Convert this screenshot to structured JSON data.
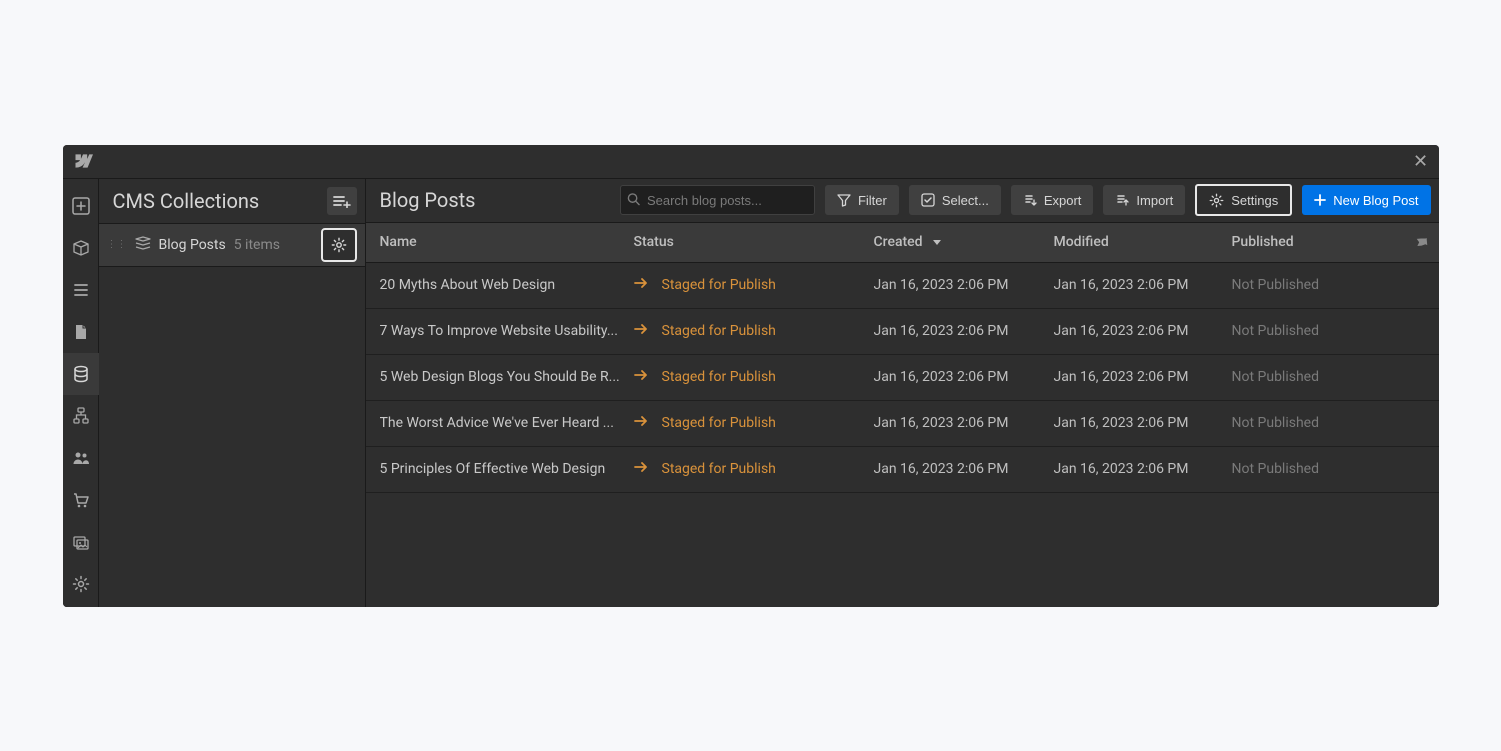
{
  "sidebar": {
    "title": "CMS Collections",
    "collection": {
      "name": "Blog Posts",
      "count": "5 items"
    }
  },
  "main": {
    "title": "Blog Posts",
    "search_placeholder": "Search blog posts...",
    "buttons": {
      "filter": "Filter",
      "select": "Select...",
      "export": "Export",
      "import": "Import",
      "settings": "Settings",
      "new": "New Blog Post"
    },
    "columns": {
      "name": "Name",
      "status": "Status",
      "created": "Created",
      "modified": "Modified",
      "published": "Published"
    },
    "rows": [
      {
        "name": "20 Myths About Web Design",
        "status": "Staged for Publish",
        "created": "Jan 16, 2023 2:06 PM",
        "modified": "Jan 16, 2023 2:06 PM",
        "published": "Not Published"
      },
      {
        "name": "7 Ways To Improve Website Usability...",
        "status": "Staged for Publish",
        "created": "Jan 16, 2023 2:06 PM",
        "modified": "Jan 16, 2023 2:06 PM",
        "published": "Not Published"
      },
      {
        "name": "5 Web Design Blogs You Should Be R...",
        "status": "Staged for Publish",
        "created": "Jan 16, 2023 2:06 PM",
        "modified": "Jan 16, 2023 2:06 PM",
        "published": "Not Published"
      },
      {
        "name": "The Worst Advice We've Ever Heard ...",
        "status": "Staged for Publish",
        "created": "Jan 16, 2023 2:06 PM",
        "modified": "Jan 16, 2023 2:06 PM",
        "published": "Not Published"
      },
      {
        "name": "5 Principles Of Effective Web Design",
        "status": "Staged for Publish",
        "created": "Jan 16, 2023 2:06 PM",
        "modified": "Jan 16, 2023 2:06 PM",
        "published": "Not Published"
      }
    ]
  }
}
